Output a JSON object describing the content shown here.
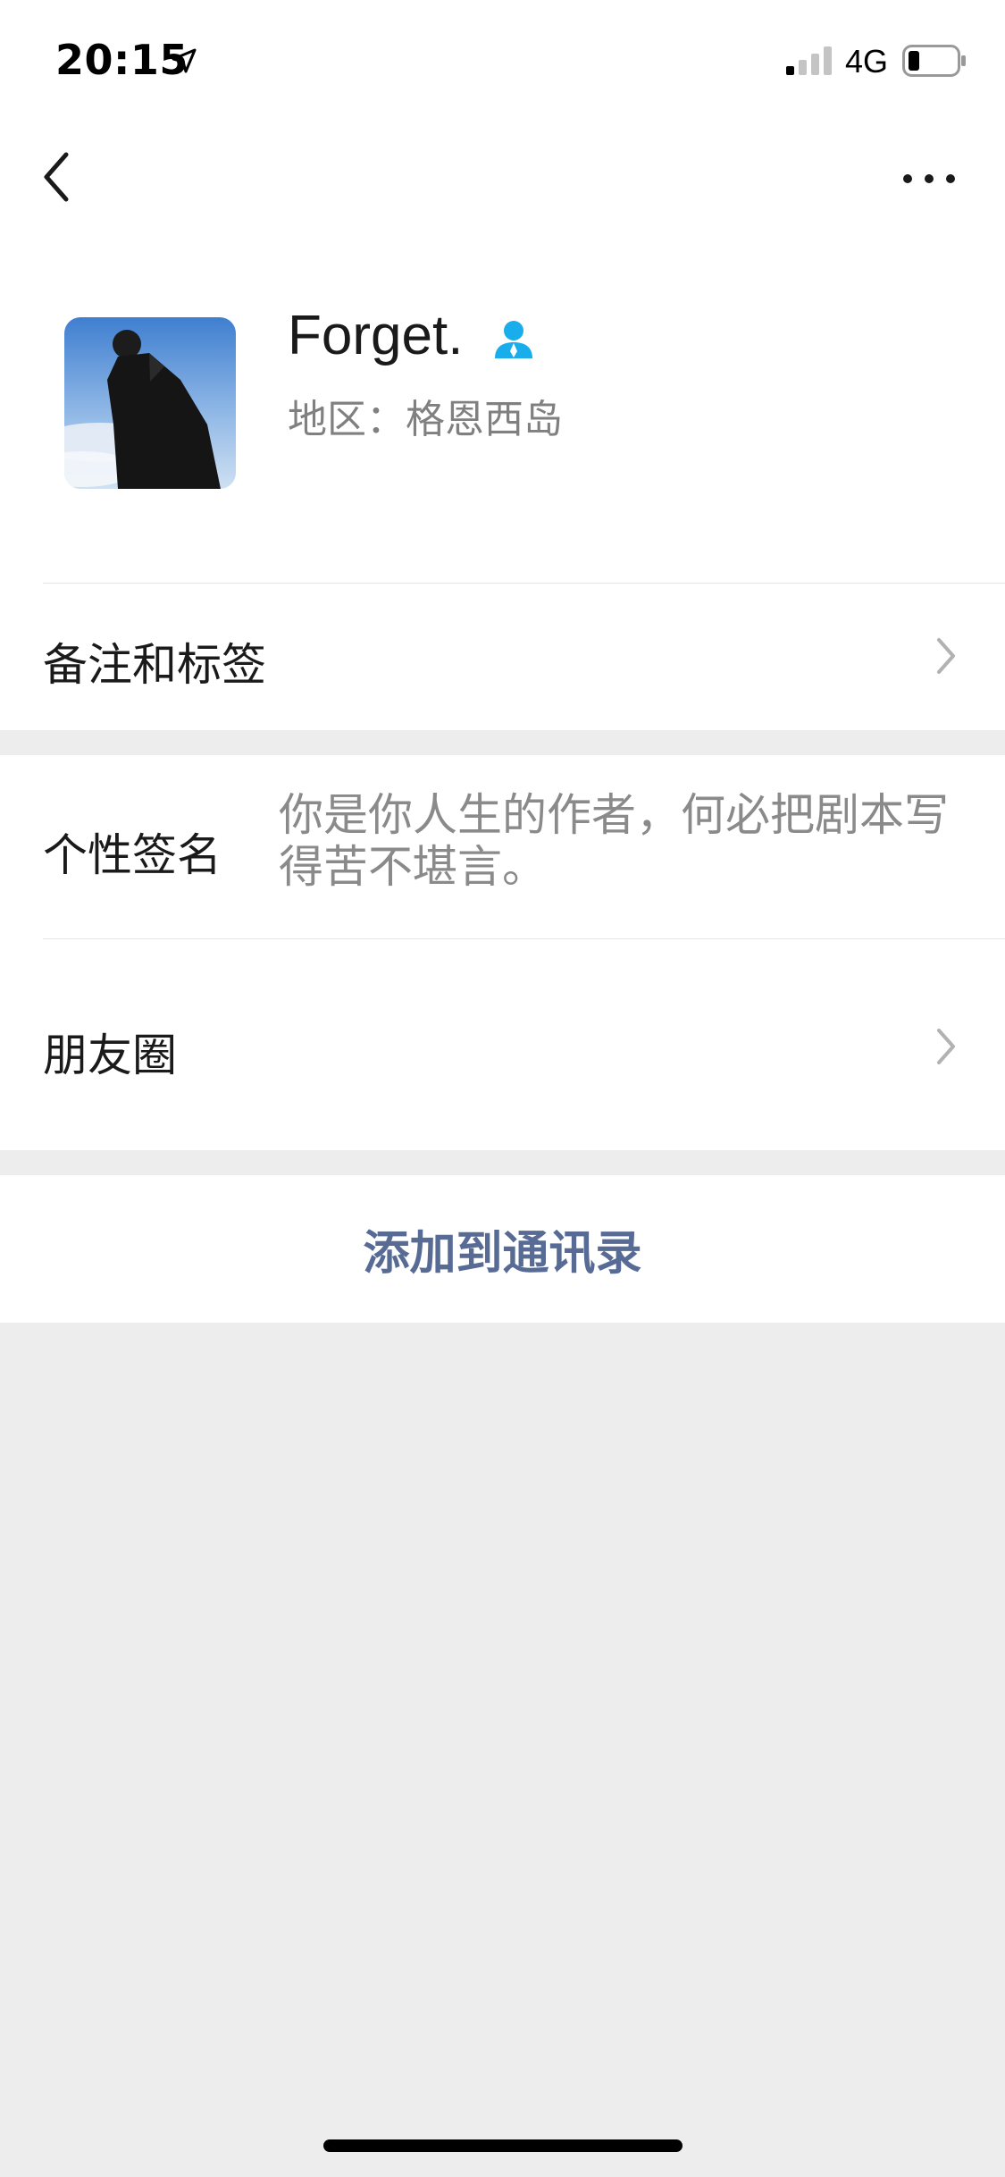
{
  "status_bar": {
    "time": "20:15",
    "network": "4G",
    "icons": [
      "location-arrow-icon",
      "signal-bars-icon",
      "battery-icon"
    ]
  },
  "nav": {
    "icons": [
      "chevron-left-icon",
      "more-dots-icon"
    ]
  },
  "profile": {
    "name": "Forget.",
    "region": "地区：格恩西岛",
    "gender_icon": "male-person-icon"
  },
  "rows": {
    "remarks_tags": "备注和标签",
    "signature_label": "个性签名",
    "signature_value": "你是你人生的作者，何必把剧本写得苦不堪言。",
    "moments": "朋友圈"
  },
  "actions": {
    "add_contact": "添加到通讯录"
  },
  "colors": {
    "background": "#ededed",
    "link_blue": "#576b95",
    "gender_blue": "#1aadec",
    "secondary_text": "#808080"
  }
}
